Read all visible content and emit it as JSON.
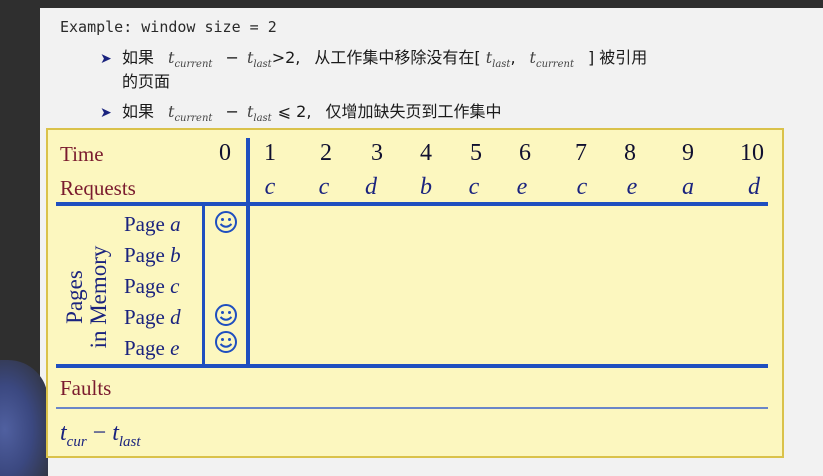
{
  "header": {
    "example_text": "Example: window size = 2"
  },
  "bullets": [
    {
      "prefix": "如果",
      "t1": "t",
      "t1_sub": "current",
      "op": "−",
      "t2": "t",
      "t2_sub": "last",
      "cond": ">2,",
      "rest_a": "从工作集中移除没有在[",
      "r1": "t",
      "r1_sub": "last",
      "comma": ",",
      "r2": "t",
      "r2_sub": "current",
      "rest_b": "] 被引用",
      "line2": "的页面"
    },
    {
      "prefix": "如果",
      "t1": "t",
      "t1_sub": "current",
      "op": "−",
      "t2": "t",
      "t2_sub": "last",
      "cond": "⩽ 2,",
      "rest": "仅增加缺失页到工作集中"
    }
  ],
  "table": {
    "time_label": "Time",
    "requests_label": "Requests",
    "faults_label": "Faults",
    "pages_label_line1": "Pages",
    "pages_label_line2": "in Memory",
    "time_values": [
      "0",
      "1",
      "2",
      "3",
      "4",
      "5",
      "6",
      "7",
      "8",
      "9",
      "10"
    ],
    "requests": [
      "c",
      "c",
      "d",
      "b",
      "c",
      "e",
      "c",
      "e",
      "a",
      "d"
    ],
    "pages": [
      {
        "prefix": "Page",
        "name": "a",
        "in_memory_at_0": true
      },
      {
        "prefix": "Page",
        "name": "b",
        "in_memory_at_0": false
      },
      {
        "prefix": "Page",
        "name": "c",
        "in_memory_at_0": false
      },
      {
        "prefix": "Page",
        "name": "d",
        "in_memory_at_0": true
      },
      {
        "prefix": "Page",
        "name": "e",
        "in_memory_at_0": true
      }
    ],
    "formula": {
      "a": "t",
      "a_sub": "cur",
      "op": "−",
      "b": "t",
      "b_sub": "last"
    }
  },
  "colors": {
    "panel_bg": "#fcf7bf",
    "panel_border": "#dac24a",
    "rule_blue": "#1f4fbf",
    "label_maroon": "#7a1b2e",
    "text_navy": "#1a237e"
  },
  "icons": {
    "in_memory_marker": "smiley-face-icon"
  }
}
